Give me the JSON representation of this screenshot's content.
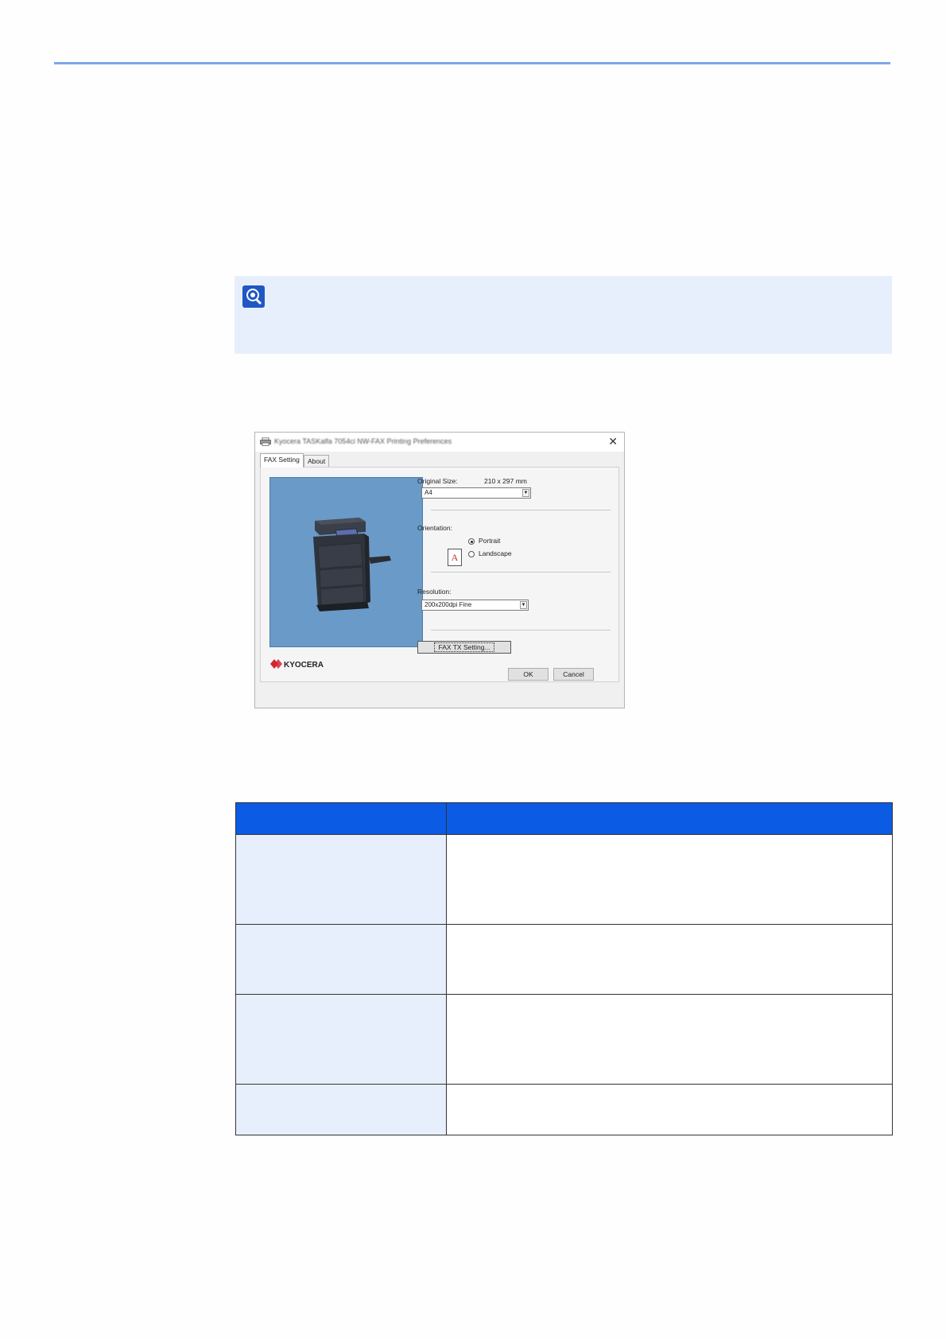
{
  "note": {
    "icon": "note-icon"
  },
  "dialog": {
    "title": "Kyocera TASKalfa 7054ci NW-FAX Printing Preferences",
    "close_label": "✕",
    "tabs": [
      "FAX Setting",
      "About"
    ],
    "brand": "KYOCERA",
    "original_size": {
      "label": "Original Size:",
      "dimensions": "210 x 297 mm",
      "value": "A4"
    },
    "orientation": {
      "label": "Orientation:",
      "icon_letter": "A",
      "options": [
        "Portrait",
        "Landscape"
      ],
      "selected": "Portrait"
    },
    "resolution": {
      "label": "Resolution:",
      "value": "200x200dpi Fine"
    },
    "fax_tx_button": "FAX TX Setting...",
    "ok_button": "OK",
    "cancel_button": "Cancel"
  },
  "colors": {
    "accent": "#0b5be5",
    "light_fill": "#e7eefc",
    "rule": "#7ea7ec",
    "preview_bg": "#6a9ac7"
  }
}
